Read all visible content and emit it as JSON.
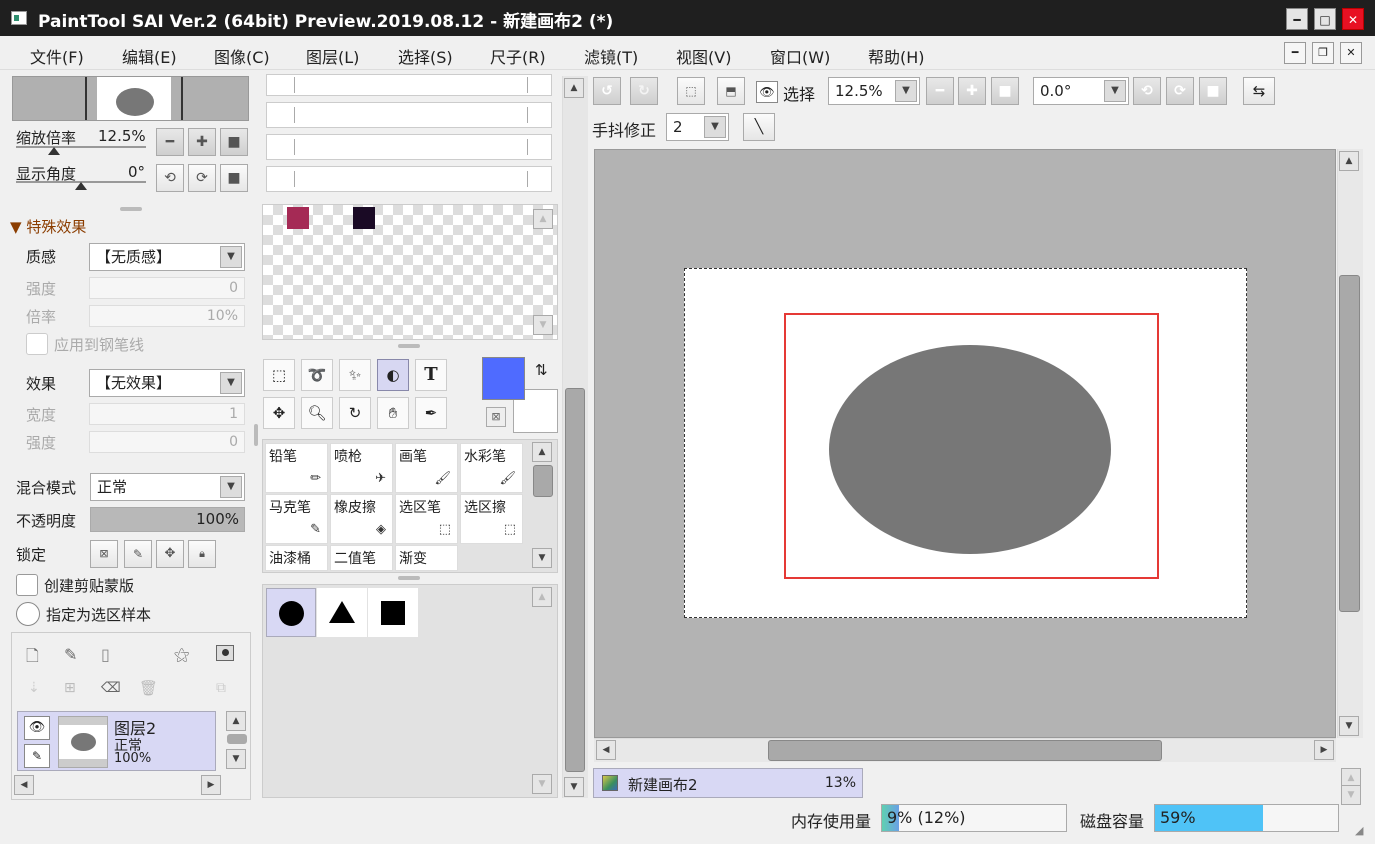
{
  "window": {
    "title": "PaintTool SAI Ver.2 (64bit) Preview.2019.08.12 - 新建画布2 (*)"
  },
  "menu": [
    "文件(F)",
    "编辑(E)",
    "图像(C)",
    "图层(L)",
    "选择(S)",
    "尺子(R)",
    "滤镜(T)",
    "视图(V)",
    "窗口(W)",
    "帮助(H)"
  ],
  "navigator": {
    "zoom_label": "缩放倍率",
    "zoom_value": "12.5%",
    "angle_label": "显示角度",
    "angle_value": "0°"
  },
  "effects": {
    "header": "特殊效果",
    "texture_label": "质感",
    "texture_value": "【无质感】",
    "strength_label": "强度",
    "strength_value": "0",
    "scale_label": "倍率",
    "scale_value": "10%",
    "apply_pen_label": "应用到钢笔线",
    "effect_label": "效果",
    "effect_value": "【无效果】",
    "width_label": "宽度",
    "width_value": "1",
    "strength2_label": "强度",
    "strength2_value": "0"
  },
  "layer_props": {
    "blend_label": "混合模式",
    "blend_value": "正常",
    "opacity_label": "不透明度",
    "opacity_value": "100%",
    "opacity_fraction": 1.0,
    "lock_label": "锁定",
    "clip_label": "创建剪贴蒙版",
    "sample_label": "指定为选区样本"
  },
  "layer": {
    "name": "图层2",
    "mode": "正常",
    "opacity": "100%"
  },
  "colors": {
    "primary": "#4f6bff",
    "secondary": "#ffffff",
    "swatches": [
      "#a52a55",
      "#1a0a25"
    ]
  },
  "brushes": [
    [
      "铅笔",
      "喷枪",
      "画笔",
      "水彩笔"
    ],
    [
      "马克笔",
      "橡皮擦",
      "选区笔",
      "选区擦"
    ],
    [
      "油漆桶",
      "二值笔",
      "渐变",
      ""
    ]
  ],
  "canvas_toolbar": {
    "select_label": "选择",
    "zoom_value": "12.5%",
    "angle_value": "0.0°",
    "stabilizer_label": "手抖修正",
    "stabilizer_value": "2"
  },
  "canvas": {
    "bg": "#b3b3b3",
    "ellipse_color": "#777777",
    "frame_color": "#e53935"
  },
  "status": {
    "doc_name": "新建画布2",
    "doc_zoom": "13%",
    "mem_label": "内存使用量",
    "mem_value": "9% (12%)",
    "mem_fraction": 0.09,
    "disk_label": "磁盘容量",
    "disk_value": "59%",
    "disk_fraction": 0.59
  }
}
